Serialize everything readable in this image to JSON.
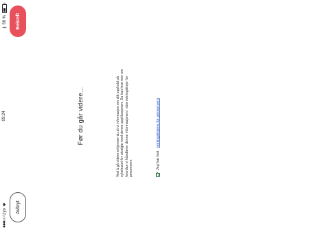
{
  "status": {
    "carrier": "Uyo",
    "time": "09:24",
    "battery_percent": "58 %"
  },
  "header": {
    "cancel_label": "Avbryt",
    "confirm_label": "Bekreft"
  },
  "title": "Før du går videre...",
  "body_text": "Ved å gå videre erkjenner du at vi informasjon om ditt opphold på sykehuset for utvalgte med denne applikasjonen. Du kan lese mer om hvordan vi håndterer denne informasjonen i våre retningslinjer for personvern",
  "consent": {
    "prefix": "Jeg har lest",
    "link_text": "retningslinjene for personvern",
    "checked": true
  }
}
